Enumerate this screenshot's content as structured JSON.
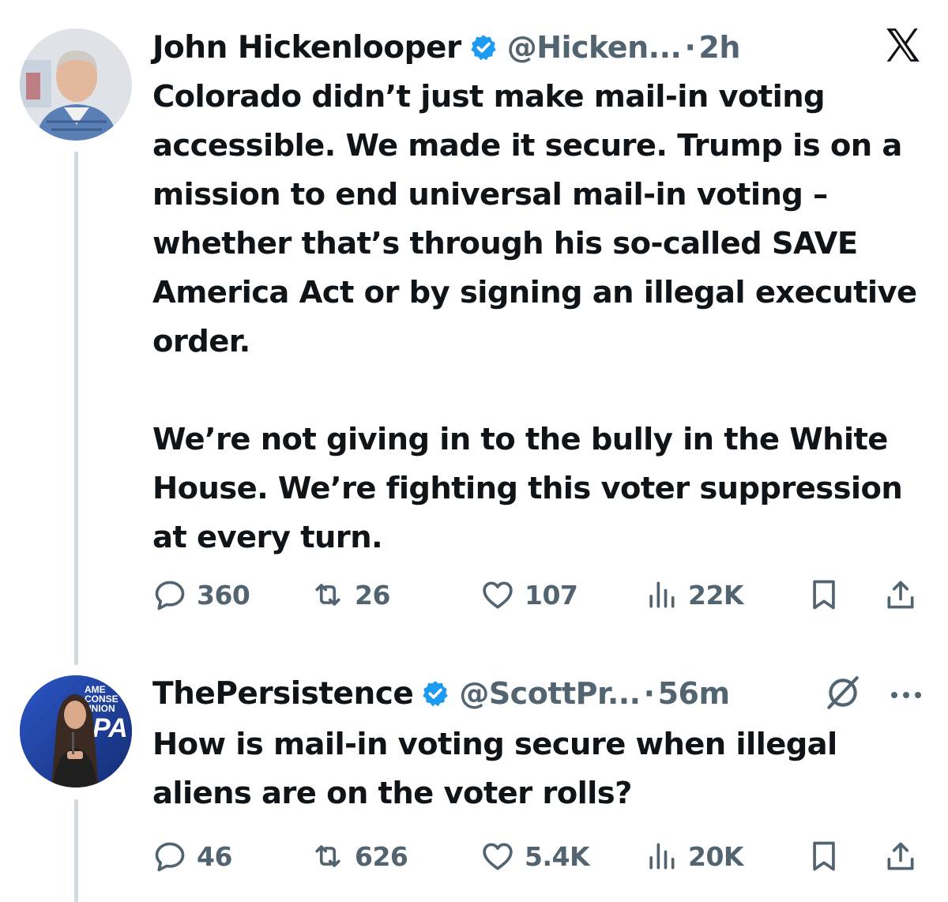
{
  "tweets": [
    {
      "author": "John Hickenlooper",
      "handle": "@Hicken...",
      "separator": "·",
      "time": "2h",
      "text": [
        "Colorado didn’t just make mail-in voting accessible. We made it secure. Trump is on a mission to end universal mail-in voting – whether that’s through his so-called SAVE America Act or by signing an illegal executive order.",
        "We’re not giving in to the bully in the White House. We’re fighting this voter suppression at every turn."
      ],
      "stats": {
        "replies": "360",
        "reposts": "26",
        "likes": "107",
        "views": "22K"
      }
    },
    {
      "author": "ThePersistence",
      "handle": "@ScottPr...",
      "separator": "·",
      "time": "56m",
      "avatar_text": [
        "AME",
        "CONSE",
        "UNION",
        "PA"
      ],
      "text": [
        "How is mail-in voting secure when illegal aliens are on the voter rolls?"
      ],
      "stats": {
        "replies": "46",
        "reposts": "626",
        "likes": "5.4K",
        "views": "20K"
      }
    }
  ],
  "colors": {
    "text": "#0f1419",
    "secondary": "#536471",
    "verified": "#1d9bf0",
    "thread_line": "#cfd9de"
  },
  "icons": [
    "x-logo-icon",
    "verified-badge-icon",
    "reply-icon",
    "repost-icon",
    "like-icon",
    "views-icon",
    "bookmark-icon",
    "share-icon",
    "grok-icon",
    "more-icon"
  ]
}
